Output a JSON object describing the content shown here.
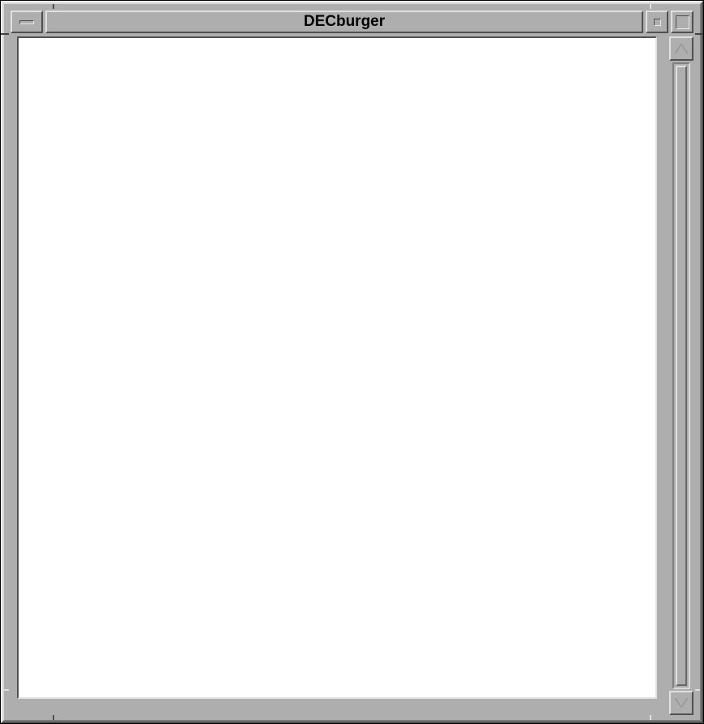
{
  "window": {
    "title": "DECburger"
  }
}
